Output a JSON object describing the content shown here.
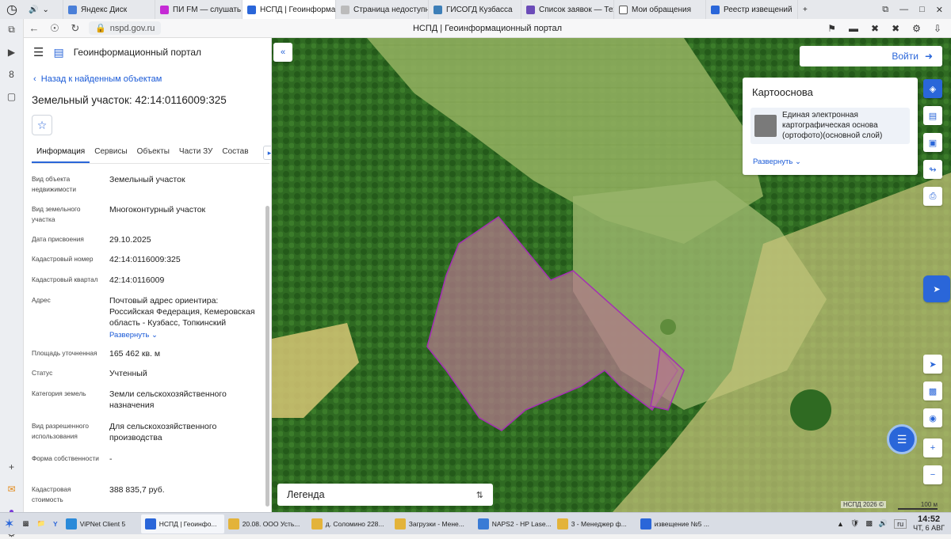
{
  "browser": {
    "tabs": [
      {
        "label": "Яндекс Диск",
        "color": "#4a7fd8"
      },
      {
        "label": "ПИ FM — слушать",
        "color": "#c52ad5"
      },
      {
        "label": "НСПД | Геоинформа",
        "color": "#2a66d9",
        "active": true
      },
      {
        "label": "Страница недоступна",
        "color": "#888888"
      },
      {
        "label": "ГИСОГД Кузбасса",
        "color": "#3d7fb8"
      },
      {
        "label": "Список заявок — Техно",
        "color": "#6b4bb8"
      },
      {
        "label": "Мои обращения",
        "color": "#555555"
      },
      {
        "label": "Реестр извещений",
        "color": "#2a66d9"
      }
    ],
    "url": "nspd.gov.ru",
    "page_title": "НСПД | Геоинформационный портал"
  },
  "panel": {
    "app_title": "Геоинформационный портал",
    "back_label": "Назад к найденным объектам",
    "title": "Земельный участок: 42:14:0116009:325",
    "tabs": [
      "Информация",
      "Сервисы",
      "Объекты",
      "Части ЗУ",
      "Состав"
    ],
    "props": [
      {
        "label": "Вид объекта недвижимости",
        "value": "Земельный участок"
      },
      {
        "label": "Вид земельного участка",
        "value": "Многоконтурный участок"
      },
      {
        "label": "Дата присвоения",
        "value": "29.10.2025"
      },
      {
        "label": "Кадастровый номер",
        "value": "42:14:0116009:325"
      },
      {
        "label": "Кадастровый квартал",
        "value": "42:14:0116009"
      },
      {
        "label": "Адрес",
        "value": "Почтовый адрес ориентира: Российская Федерация, Кемеровская область - Кузбасс, Топкинский",
        "expand": "Развернуть"
      },
      {
        "label": "Площадь уточненная",
        "value": "165 462 кв. м"
      },
      {
        "label": "Статус",
        "value": "Учтенный"
      },
      {
        "label": "Категория земель",
        "value": "Земли сельскохозяйственного назначения"
      },
      {
        "label": "Вид разрешенного использования",
        "value": "Для сельскохозяйственного производства"
      },
      {
        "label": "Форма собственности",
        "value": "-"
      },
      {
        "label": "Кадастровая стоимость",
        "value": "388 835,7 руб."
      }
    ]
  },
  "map": {
    "login_label": "Войти",
    "basemap": {
      "title": "Картооснова",
      "layer": "Единая электронная картографическая основа (ортофото)(основной слой)",
      "expand": "Развернуть"
    },
    "legend_label": "Легенда",
    "copyright": "НСПД 2026 ©",
    "scale_label": "100 м",
    "parcel_color": "#a52fb3"
  },
  "taskbar": {
    "items": [
      {
        "label": "ViPNet Client 5",
        "color": "#2a8ad9"
      },
      {
        "label": "НСПД | Геоинфо...",
        "color": "#2a66d9",
        "active": true
      },
      {
        "label": "20.08. ООО Усть...",
        "color": "#e3b33a"
      },
      {
        "label": "д. Соломино 228...",
        "color": "#e3b33a"
      },
      {
        "label": "Загрузки - Мене...",
        "color": "#e3b33a"
      },
      {
        "label": "NAPS2 - HP Lase...",
        "color": "#3a7bd5"
      },
      {
        "label": "3 - Менеджер ф...",
        "color": "#e3b33a"
      },
      {
        "label": "извещение №5 ...",
        "color": "#2a66d9"
      }
    ],
    "lang": "ru",
    "time": "14:52",
    "date": "ЧТ, 6 АВГ"
  }
}
